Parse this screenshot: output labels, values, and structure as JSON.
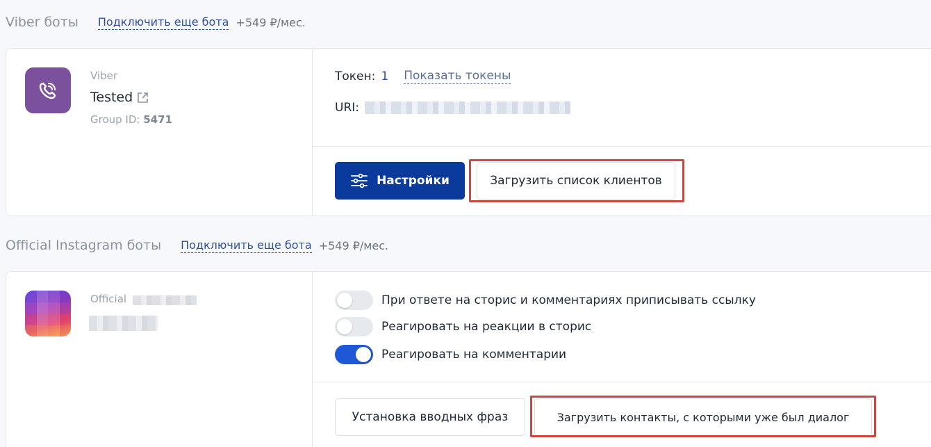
{
  "viber_section": {
    "title": "Viber боты",
    "connect_link": "Подключить еще бота",
    "price": "+549 ₽/мес.",
    "bot": {
      "platform": "Viber",
      "name": "Tested",
      "group_label": "Group ID:",
      "group_id": "5471",
      "token_label": "Токен:",
      "token_count": "1",
      "show_tokens": "Показать токены",
      "uri_label": "URI:",
      "settings_button": "Настройки",
      "upload_clients_button": "Загрузить список клиентов"
    }
  },
  "instagram_section": {
    "title": "Official Instagram боты",
    "connect_link": "Подключить еще бота",
    "price": "+549 ₽/мес.",
    "bot": {
      "platform": "Official",
      "toggles": [
        {
          "label": "При ответе на сторис и комментариях приписывать ссылку",
          "on": false
        },
        {
          "label": "Реагировать на реакции в сторис",
          "on": false
        },
        {
          "label": "Реагировать на комментарии",
          "on": true
        }
      ],
      "intro_phrases_button": "Установка вводных фраз",
      "upload_contacts_button": "Загрузить контакты, с которыми уже был диалог"
    }
  },
  "colors": {
    "accent": "#0a3a9c",
    "link": "#2f4fa8",
    "toggle_on": "#1f58d6",
    "highlight": "#c8493f",
    "viber": "#7b519d"
  }
}
